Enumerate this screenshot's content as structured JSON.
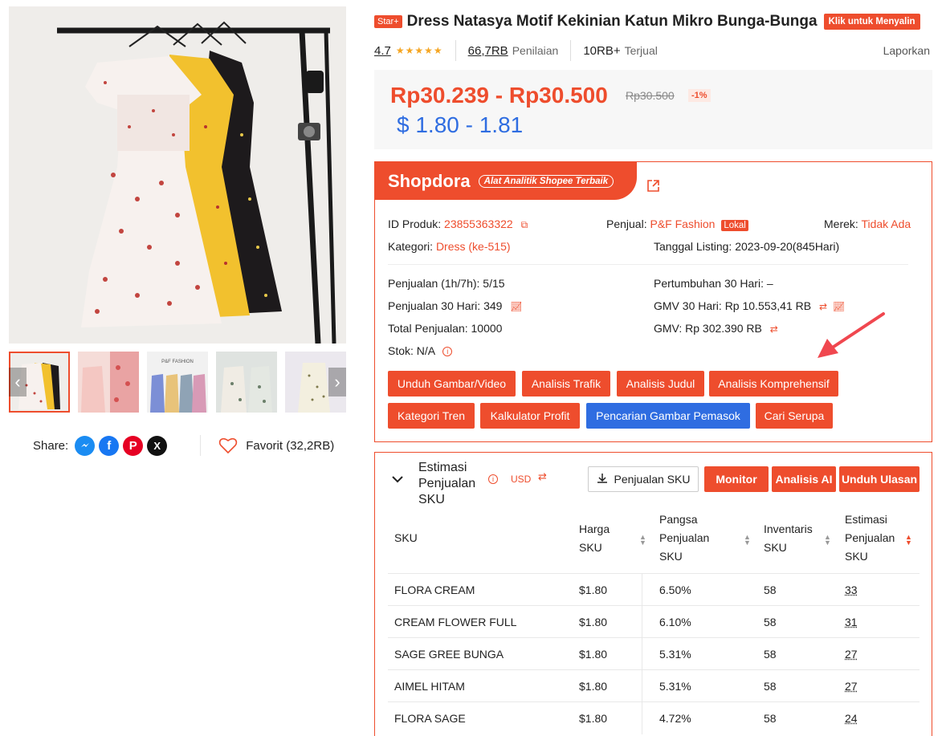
{
  "product": {
    "badge": "Star+",
    "title": "Dress Natasya Motif Kekinian Katun Mikro Bunga-Bunga",
    "copy_label": "Klik untuk Menyalin",
    "rating": "4.7",
    "stars": "★★★★★",
    "reviews_count": "66,7RB",
    "reviews_label": "Penilaian",
    "sold_count": "10RB+",
    "sold_label": "Terjual",
    "report_label": "Laporkan",
    "price_range": "Rp30.239 - Rp30.500",
    "price_old": "Rp30.500",
    "discount": "-1%",
    "price_usd": "$ 1.80 - 1.81"
  },
  "gallery": {
    "shop_watermark": "P&F FASHION"
  },
  "share": {
    "label": "Share:",
    "favorite_label": "Favorit (32,2RB)"
  },
  "shopdora": {
    "brand": "Shopdora",
    "tagline": "Alat Analitik Shopee Terbaik",
    "product_id_label": "ID Produk:",
    "product_id": "23855363322",
    "seller_label": "Penjual:",
    "seller": "P&F Fashion",
    "seller_tag": "Lokal",
    "brand_label": "Merek:",
    "brand_value": "Tidak Ada",
    "category_label": "Kategori:",
    "category": "Dress  (ke-515)",
    "listing_label": "Tanggal Listing:",
    "listing_date": "2023-09-20(845Hari)",
    "sales_1h7h": "Penjualan (1h/7h): 5/15",
    "growth_30d": "Pertumbuhan 30 Hari: –",
    "sales_30d": "Penjualan 30 Hari: 349",
    "gmv_30d": "GMV 30 Hari: Rp 10.553,41 RB",
    "total_sales": "Total Penjualan: 10000",
    "gmv": "GMV: Rp 302.390 RB",
    "stock": "Stok: N/A",
    "buttons": [
      "Unduh Gambar/Video",
      "Analisis Trafik",
      "Analisis Judul",
      "Analisis Komprehensif",
      "Kategori Tren",
      "Kalkulator Profit",
      "Pencarian Gambar Pemasok",
      "Cari Serupa"
    ]
  },
  "sku": {
    "title": "Estimasi Penjualan SKU",
    "currency": "USD",
    "export_label": "Penjualan SKU",
    "monitor_label": "Monitor",
    "ai_label": "Analisis AI",
    "reviews_label": "Unduh Ulasan",
    "headers": {
      "sku": "SKU",
      "price": "Harga SKU",
      "share": "Pangsa Penjualan SKU",
      "inventory": "Inventaris SKU",
      "estimate": "Estimasi Penjualan SKU"
    },
    "rows": [
      {
        "name": "FLORA CREAM",
        "price": "$1.80",
        "share": "6.50%",
        "inventory": "58",
        "estimate": "33"
      },
      {
        "name": "CREAM FLOWER FULL",
        "price": "$1.80",
        "share": "6.10%",
        "inventory": "58",
        "estimate": "31"
      },
      {
        "name": "SAGE GREE BUNGA",
        "price": "$1.80",
        "share": "5.31%",
        "inventory": "58",
        "estimate": "27"
      },
      {
        "name": "AIMEL HITAM",
        "price": "$1.80",
        "share": "5.31%",
        "inventory": "58",
        "estimate": "27"
      },
      {
        "name": "FLORA SAGE",
        "price": "$1.80",
        "share": "4.72%",
        "inventory": "58",
        "estimate": "24"
      }
    ]
  },
  "colors": {
    "accent": "#ee4d2d",
    "blue": "#2f6de1"
  }
}
